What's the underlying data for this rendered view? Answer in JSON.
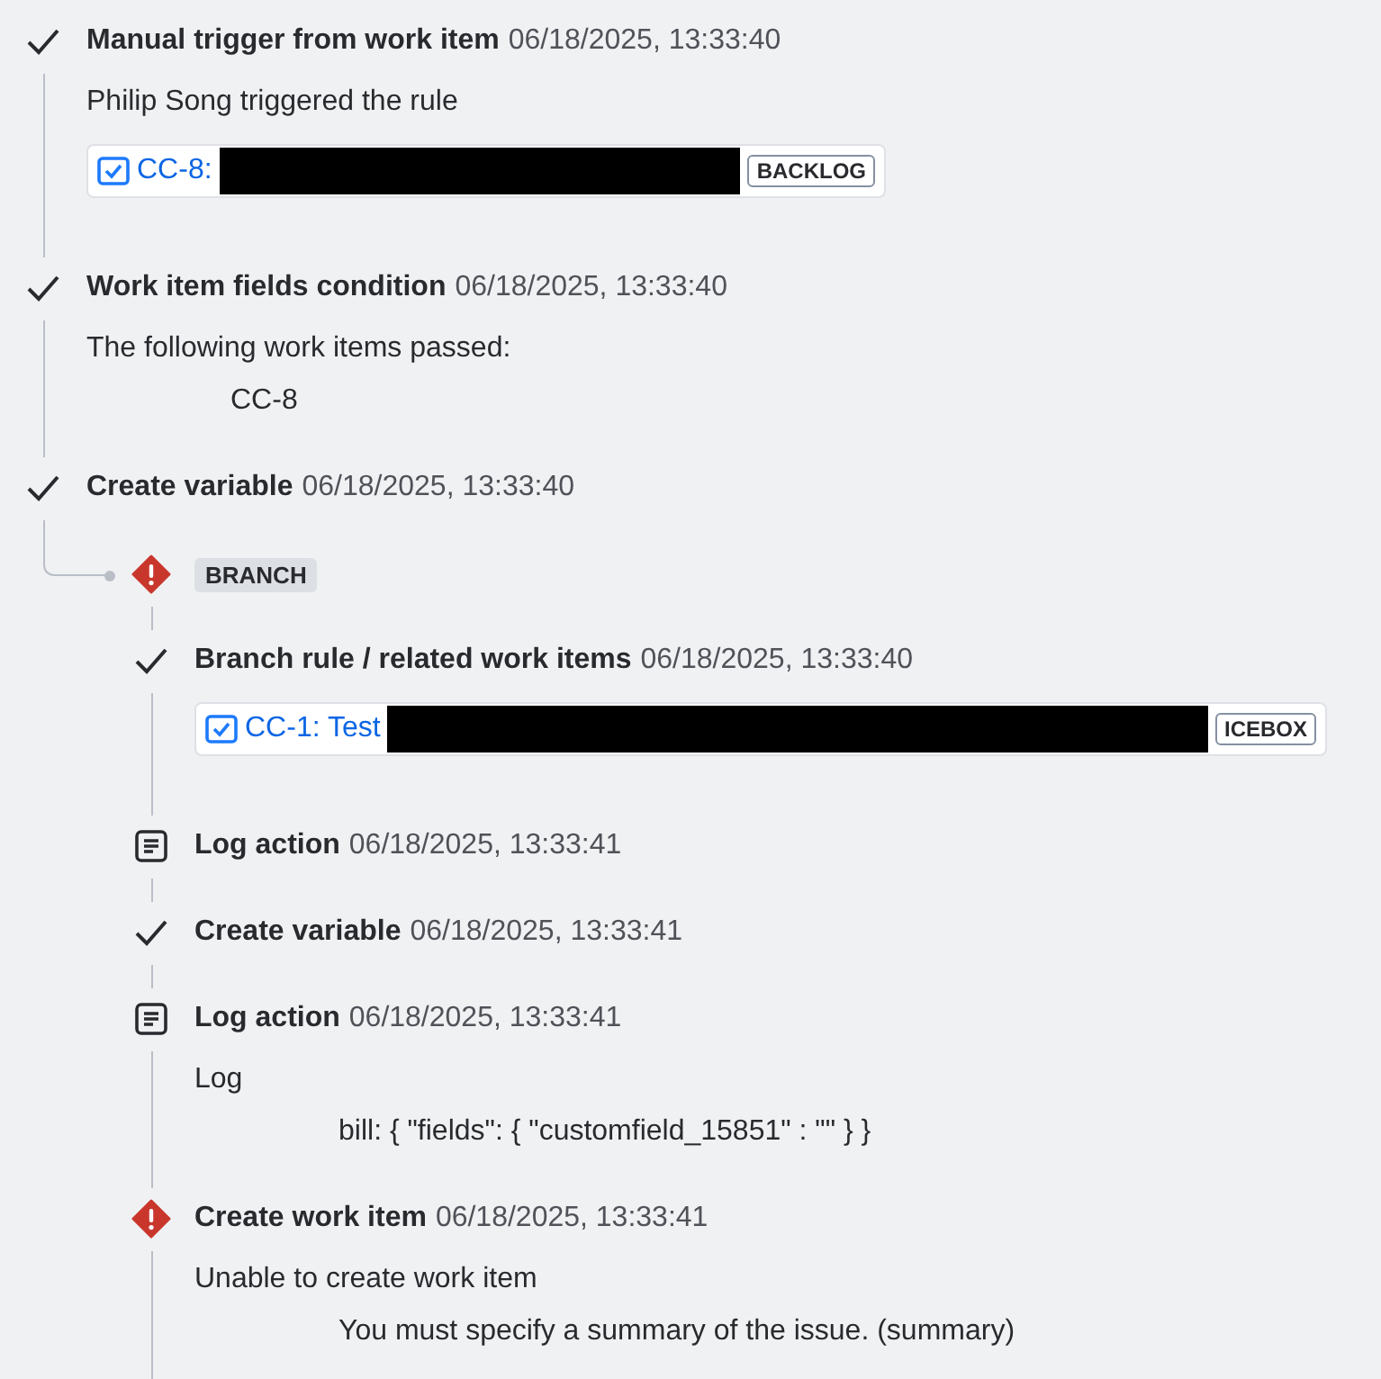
{
  "entries": [
    {
      "kind": "success",
      "title": "Manual trigger from work item",
      "time": "06/18/2025, 13:33:40",
      "body": [
        {
          "kind": "text",
          "text": "Philip Song triggered the rule"
        },
        {
          "kind": "card",
          "key": "CC-8:",
          "redacted": true,
          "lozenge": "BACKLOG"
        }
      ]
    },
    {
      "kind": "success",
      "title": "Work item fields condition",
      "time": "06/18/2025, 13:33:40",
      "body": [
        {
          "kind": "text",
          "text": "The following work items passed:"
        },
        {
          "kind": "indented",
          "text": "CC-8"
        }
      ]
    },
    {
      "kind": "success",
      "title": "Create variable",
      "time": "06/18/2025, 13:33:40"
    },
    {
      "kind": "branch",
      "label": "BRANCH",
      "children": [
        {
          "kind": "success",
          "title": "Branch rule / related work items",
          "time": "06/18/2025, 13:33:40",
          "body": [
            {
              "kind": "card",
              "key": "CC-1: Test",
              "redacted": true,
              "lozenge": "ICEBOX"
            }
          ]
        },
        {
          "kind": "log",
          "title": "Log action",
          "time": "06/18/2025, 13:33:41"
        },
        {
          "kind": "success",
          "title": "Create variable",
          "time": "06/18/2025, 13:33:41"
        },
        {
          "kind": "log",
          "title": "Log action",
          "time": "06/18/2025, 13:33:41",
          "body": [
            {
              "kind": "text",
              "text": "Log"
            },
            {
              "kind": "indented",
              "text": "bill: { \"fields\": { \"customfield_15851\" : \"\" } }"
            }
          ]
        },
        {
          "kind": "error",
          "title": "Create work item",
          "time": "06/18/2025, 13:33:41",
          "body": [
            {
              "kind": "text",
              "text": "Unable to create work item"
            },
            {
              "kind": "indented",
              "text": "You must specify a summary of the issue. (summary)"
            }
          ]
        }
      ]
    }
  ]
}
